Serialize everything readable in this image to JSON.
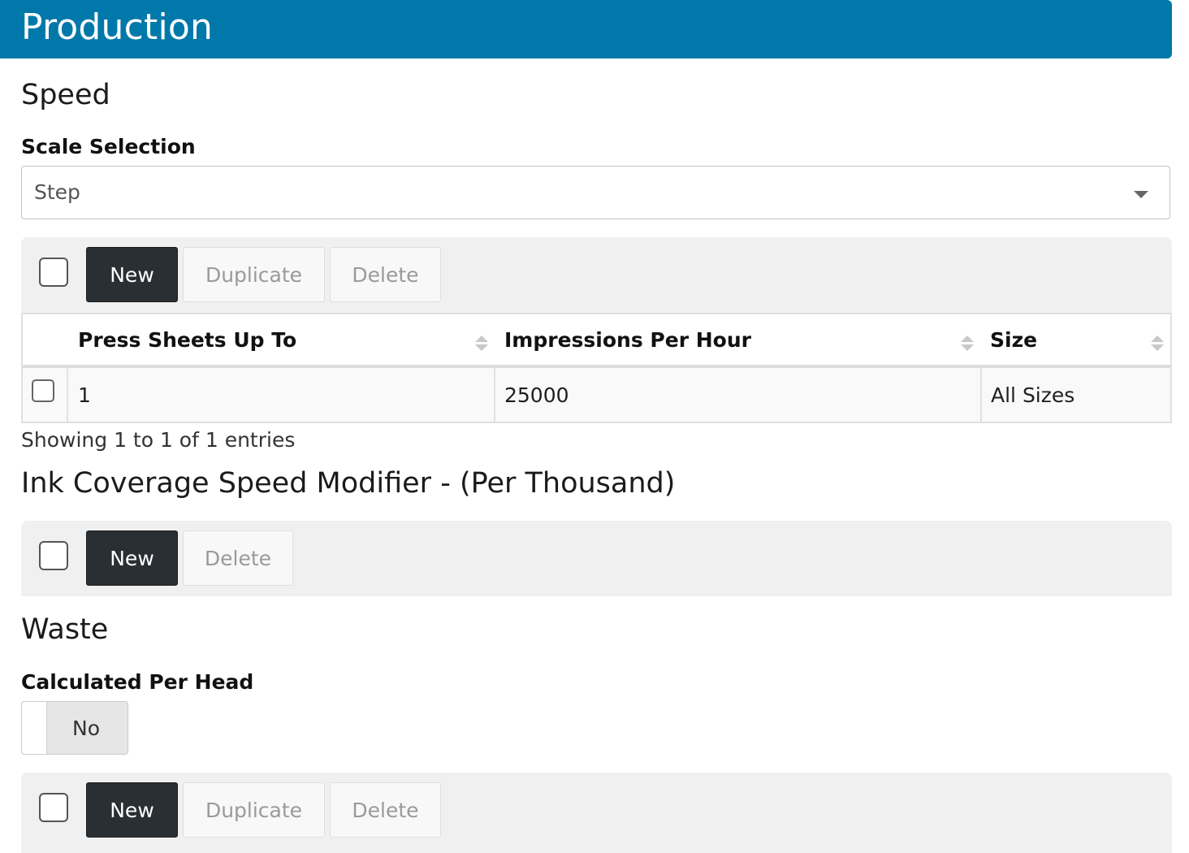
{
  "header": {
    "title": "Production"
  },
  "speed": {
    "title": "Speed",
    "scale_label": "Scale Selection",
    "scale_value": "Step",
    "toolbar": {
      "new": "New",
      "duplicate": "Duplicate",
      "delete": "Delete"
    },
    "table": {
      "columns": [
        "Press Sheets Up To",
        "Impressions Per Hour",
        "Size"
      ],
      "rows": [
        {
          "press_sheets": "1",
          "impressions": "25000",
          "size": "All Sizes"
        }
      ]
    },
    "showing": "Showing 1 to 1 of 1 entries"
  },
  "ink": {
    "title": "Ink Coverage Speed Modifier - (Per Thousand)",
    "toolbar": {
      "new": "New",
      "delete": "Delete"
    }
  },
  "waste": {
    "title": "Waste",
    "per_head_label": "Calculated Per Head",
    "per_head_value": "No",
    "toolbar": {
      "new": "New",
      "duplicate": "Duplicate",
      "delete": "Delete"
    }
  },
  "colors": {
    "header": "#0078aa",
    "dark_button": "#2a2f34"
  }
}
